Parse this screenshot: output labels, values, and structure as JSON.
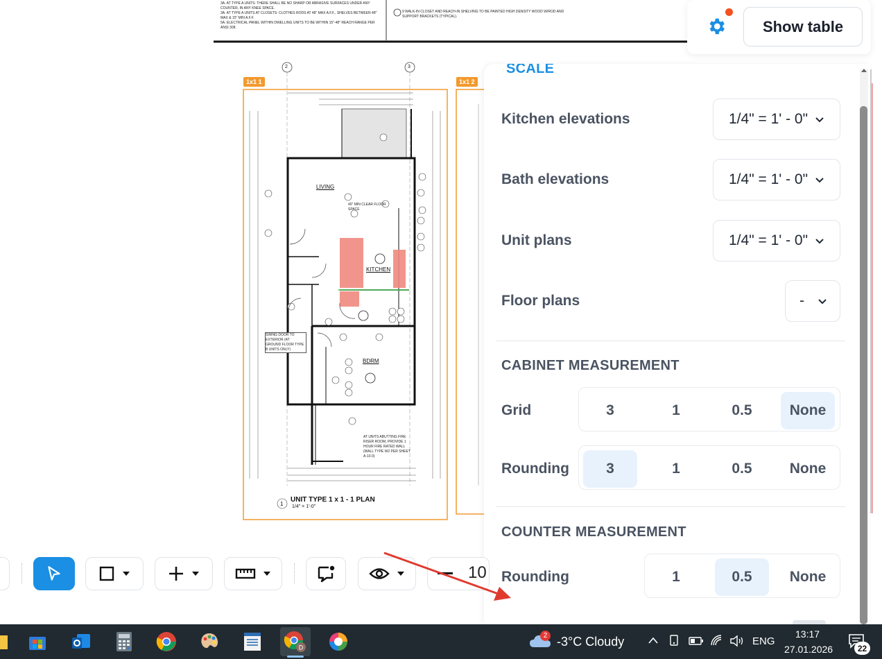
{
  "drawing": {
    "sheet_tags": [
      "1x1 1",
      "1x1 2"
    ],
    "plan_title": "UNIT TYPE 1 x 1 - 1 PLAN",
    "plan_scale": "1/4\" = 1'-0\"",
    "plan_number": "1",
    "rooms": [
      "LIVING",
      "KITCHEN",
      "BDRM"
    ],
    "grid_markers": [
      "2",
      "3"
    ],
    "notes_left": [
      "3A.  AT TYPE A UNITS: THERE SHALL BE NO SHARP OR ABRASIVE SURFACES UNDER ANY COUNTER, IN ANY KNEE SPACE.",
      "3A.  AT TYPE A UNITS AT CLOSETS: CLOTHES RODS AT 48\" MAX A.F.F., SHELVES BETWEEN 48\" MAX & 15\" MIN A.F.F.",
      "5A.  ELECTRICAL PANEL WITHIN DWELLING UNITS TO BE WITHIN 15\"-48\" REACH RANGE PER ANSI 308."
    ],
    "notes_right": [
      "9   WALK-IN CLOSET AND REACH-IN SHELVING TO BE PAINTED HIGH DENSITY WOOD W/ROD AND SUPPORT BRACKETS (TYPICAL)."
    ],
    "callouts": [
      "SWING DOOR TO EXTERIOR (AT GROUND FLOOR TYPE B UNITS ONLY)",
      "AT UNITS ABUTTING FIRE RISER ROOM, PROVIDE 1 HOUR FIRE RATED WALL (WALL TYPE W2 PER SHEET A-10.0)",
      "40\" MIN CLEAR FLOOR SPACE"
    ]
  },
  "top_actions": {
    "settings_icon": "gear-icon",
    "show_table_label": "Show table"
  },
  "panel": {
    "scale_heading": "SCALE",
    "scale_rows": [
      {
        "label": "Kitchen elevations",
        "value": "1/4\" = 1' - 0\""
      },
      {
        "label": "Bath elevations",
        "value": "1/4\" = 1' - 0\""
      },
      {
        "label": "Unit plans",
        "value": "1/4\" = 1' - 0\""
      },
      {
        "label": "Floor plans",
        "value": "-"
      }
    ],
    "cabinet_heading": "CABINET MEASUREMENT",
    "cabinet_grid": {
      "label": "Grid",
      "options": [
        "3",
        "1",
        "0.5",
        "None"
      ],
      "selected": "None"
    },
    "cabinet_rounding": {
      "label": "Rounding",
      "options": [
        "3",
        "1",
        "0.5",
        "None"
      ],
      "selected": "3"
    },
    "counter_heading": "COUNTER MEASUREMENT",
    "counter_rounding": {
      "label": "Rounding",
      "options": [
        "1",
        "0.5",
        "None"
      ],
      "selected": "0.5"
    }
  },
  "toolbar": {
    "zoom_value": "10",
    "tools": [
      "select-pointer",
      "rectangle",
      "add",
      "measure-ruler",
      "comment",
      "visibility",
      "zoom-out"
    ]
  },
  "taskbar": {
    "weather_badge": "2",
    "weather_text": "-3°C  Cloudy",
    "language": "ENG",
    "time": "13:17",
    "date": "27.01.2026",
    "notification_count": "22"
  },
  "colors": {
    "accent": "#1a8fe3",
    "selected_segment": "#e8f2fc",
    "sheet_border": "#f29a2e",
    "arrow": "#e03a2f",
    "taskbar": "#202a30",
    "highlight_red": "#f08a80"
  }
}
